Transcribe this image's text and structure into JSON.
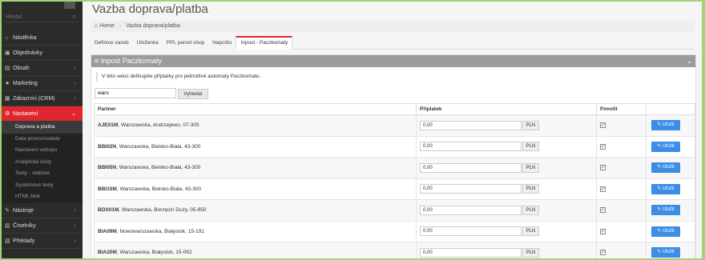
{
  "sidebar": {
    "search_placeholder": "Hledat",
    "items": [
      {
        "icon": "⌂",
        "label": "Nástěnka",
        "chev": ""
      },
      {
        "icon": "▣",
        "label": "Objednávky",
        "chev": ""
      },
      {
        "icon": "▤",
        "label": "Obsah",
        "chev": "‹"
      },
      {
        "icon": "★",
        "label": "Marketing",
        "chev": "‹"
      },
      {
        "icon": "▦",
        "label": "Zákazníci (CRM)",
        "chev": "‹"
      },
      {
        "icon": "⚙",
        "label": "Nastavení",
        "chev": "⌄"
      }
    ],
    "subitems": [
      "Doprava a platba",
      "Data provozovatele",
      "Nastavení eshopu",
      "Analytické kódy",
      "Texty - statické",
      "Systémové texty",
      "HTML blok"
    ],
    "items_after": [
      {
        "icon": "✎",
        "label": "Nástroje",
        "chev": "‹"
      },
      {
        "icon": "▥",
        "label": "Číselníky",
        "chev": "‹"
      },
      {
        "icon": "▧",
        "label": "Překlady",
        "chev": "‹"
      }
    ]
  },
  "header": {
    "title": "Vazba doprava/platba"
  },
  "breadcrumb": {
    "home": "Home",
    "current": "Vazba doprava/platba",
    "sep": "›",
    "home_icon": "⌂"
  },
  "tabs": [
    "Definice vazeb",
    "Uloženka",
    "PPL parcel shop",
    "Napoštu",
    "Inpost - Paczkomaty"
  ],
  "panel": {
    "title": "Inpost Paczkomaty",
    "note": "V této sekci definujete příplatky pro jednotlivé automaty Paczkomatu.",
    "filter_value": "wars",
    "filter_button": "Vyhledat"
  },
  "table": {
    "headers": [
      "Partner",
      "Příplatek",
      "Povolit",
      ""
    ],
    "rows": [
      {
        "code": "AJE01M",
        "addr": ", Warszawska, Andrzejewo, 07-305",
        "price": "0,00",
        "currency": "PLN",
        "save": "Uložit"
      },
      {
        "code": "BBI02N",
        "addr": ", Warszawska, Bielsko-Biała, 43-300",
        "price": "0,00",
        "currency": "PLN",
        "save": "Uložit"
      },
      {
        "code": "BBI05N",
        "addr": ", Warszawska, Bielsko-Biała, 43-300",
        "price": "0,00",
        "currency": "PLN",
        "save": "Uložit"
      },
      {
        "code": "BBI15M",
        "addr": ", Warszawska, Bielsko-Biała, 43-300",
        "price": "0,00",
        "currency": "PLN",
        "save": "Uložit"
      },
      {
        "code": "BDX01M",
        "addr": ", Warszawska, Borzęcin Duży, 05-850",
        "price": "0,00",
        "currency": "PLN",
        "save": "Uložit"
      },
      {
        "code": "BIA09M",
        "addr": ", Nowowarszawska, Białystok, 15-191",
        "price": "0,00",
        "currency": "PLN",
        "save": "Uložit"
      },
      {
        "code": "BIA20M",
        "addr": ", Warszawska, Białystok, 15-062",
        "price": "0,00",
        "currency": "PLN",
        "save": "Uložit"
      }
    ]
  },
  "colors": {
    "accent": "#e0262e",
    "button": "#3c8de6",
    "sidebar": "#2b2b2b"
  }
}
